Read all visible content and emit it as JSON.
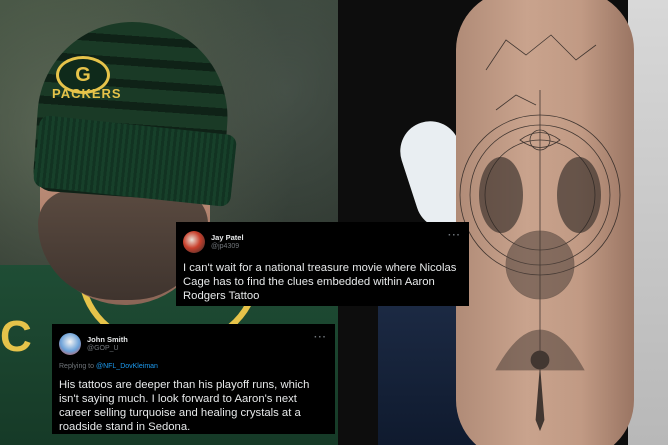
{
  "photo_left": {
    "description_icon": "person-photo",
    "beanie_logo": "G",
    "beanie_text": "PACKERS",
    "jersey_text": "C"
  },
  "photo_right": {
    "description_icon": "tattoo-photo"
  },
  "tweets": [
    {
      "name": "Jay Patel",
      "handle": "@jp4309",
      "more": "···",
      "text": "I can't wait for a national treasure movie where Nicolas Cage has to find the clues embedded within Aaron Rodgers Tattoo"
    },
    {
      "name": "John Smith",
      "handle": "@GOP_U",
      "more": "···",
      "reply_prefix": "Replying to",
      "reply_mention": "@NFL_DovKleiman",
      "text": "His tattoos are deeper than his playoff runs, which isn't saying much. I look forward to Aaron's next career selling turquoise and healing crystals at a roadside stand in Sedona."
    }
  ],
  "colors": {
    "tweet_bg": "#000000",
    "text_primary": "#e7e9ea",
    "text_secondary": "#71767b",
    "link_blue": "#1d9bf0",
    "packers_green": "#1f4d35",
    "packers_gold": "#e6c34a"
  }
}
